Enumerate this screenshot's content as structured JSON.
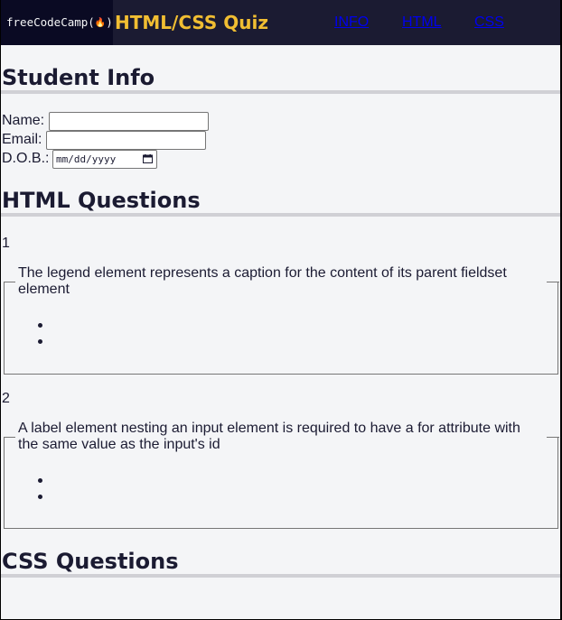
{
  "header": {
    "logo_text": "freeCodeCamp(🔥)",
    "logo_label": "freeCodeCamp(",
    "logo_flame": "🔥",
    "logo_close": ")",
    "title": "HTML/CSS Quiz",
    "nav": [
      {
        "label": "INFO"
      },
      {
        "label": "HTML"
      },
      {
        "label": "CSS"
      }
    ]
  },
  "student_info": {
    "heading": "Student Info",
    "name_label": "Name:",
    "name_value": "",
    "email_label": "Email:",
    "email_value": "",
    "dob_label": "D.O.B.:",
    "dob_placeholder": "mm/dd/yyyy"
  },
  "html_questions": {
    "heading": "HTML Questions",
    "questions": [
      {
        "number": "1",
        "text": "The legend element represents a caption for the content of its parent fieldset element"
      },
      {
        "number": "2",
        "text": "A label element nesting an input element is required to have a for attribute with the same value as the input's id"
      }
    ]
  },
  "css_questions": {
    "heading": "CSS Questions"
  },
  "colors": {
    "header_bg": "#1b1b32",
    "logo_bg": "#0a0a23",
    "title": "#f1be32",
    "link": "#0000ee",
    "page_bg": "#f4f5f7",
    "text": "#1b1b32"
  }
}
